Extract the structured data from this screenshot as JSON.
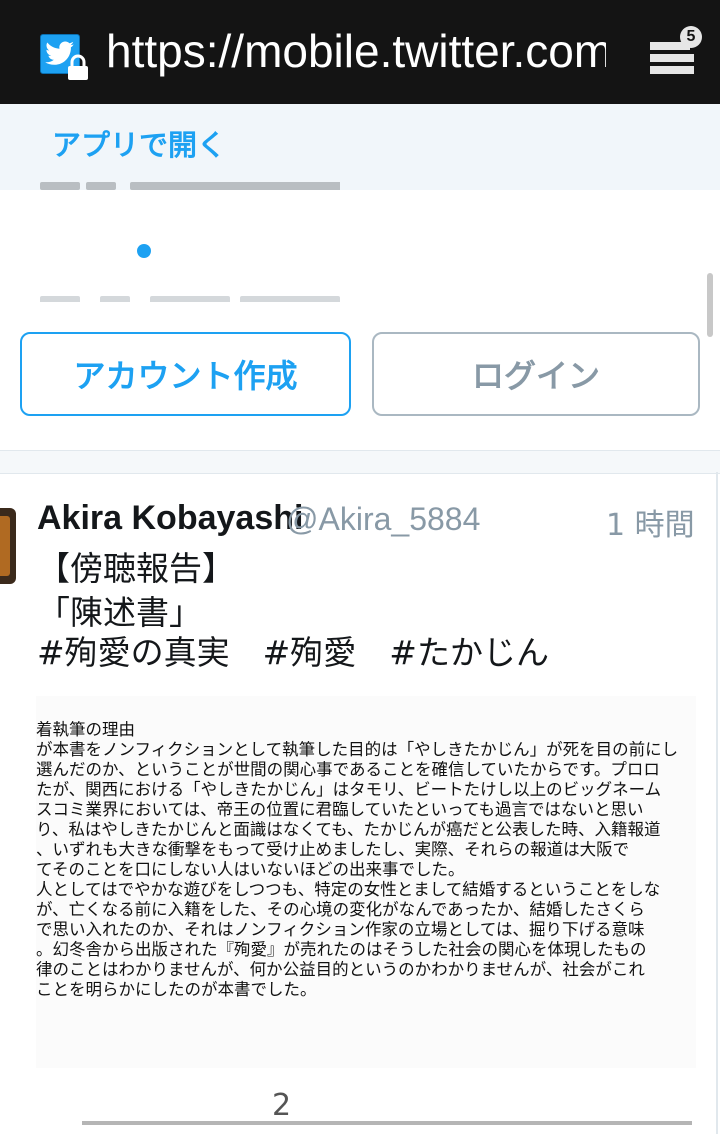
{
  "browser": {
    "url": "https://mobile.twitter.com",
    "tab_count": "5"
  },
  "banner": {
    "open_in_app": "アプリで開く"
  },
  "auth": {
    "signup_label": "アカウント作成",
    "login_label": "ログイン"
  },
  "tweet": {
    "author_name": "Akira Kobayashi",
    "author_handle": "@Akira_5884",
    "time": "1 時間",
    "lines": [
      "【傍聴報告】",
      "「陳述書」",
      "#殉愛の真実　#殉愛　#たかじん"
    ],
    "image_text": [
      "着執筆の理由",
      "が本書をノンフィクションとして執筆した目的は「やしきたかじん」が死を目の前にし",
      "選んだのか、ということが世間の関心事であることを確信していたからです。プロロ",
      "たが、関西における「やしきたかじん」はタモリ、ビートたけし以上のビッグネーム",
      "スコミ業界においては、帝王の位置に君臨していたといっても過言ではないと思い",
      "り、私はやしきたかじんと面識はなくても、たかじんが癌だと公表した時、入籍報道",
      "、いずれも大きな衝撃をもって受け止めましたし、実際、それらの報道は大阪で",
      "てそのことを口にしない人はいないほどの出来事でした。",
      "人としてはでやかな遊びをしつつも、特定の女性とまして結婚するということをしな",
      "が、亡くなる前に入籍をした、その心境の変化がなんであったか、結婚したさくら",
      "で思い入れたのか、それはノンフィクション作家の立場としては、掘り下げる意味",
      "。幻冬舎から出版された『殉愛』が売れたのはそうした社会の関心を体現したもの",
      "律のことはわかりませんが、何か公益目的というのかわかりませんが、社会がこれ",
      "ことを明らかにしたのが本書でした。"
    ]
  },
  "footer": {
    "page_number": "2"
  },
  "colors": {
    "twitter_blue": "#1da1f2",
    "muted_gray": "#8899a6",
    "url_bar": "#141414"
  }
}
